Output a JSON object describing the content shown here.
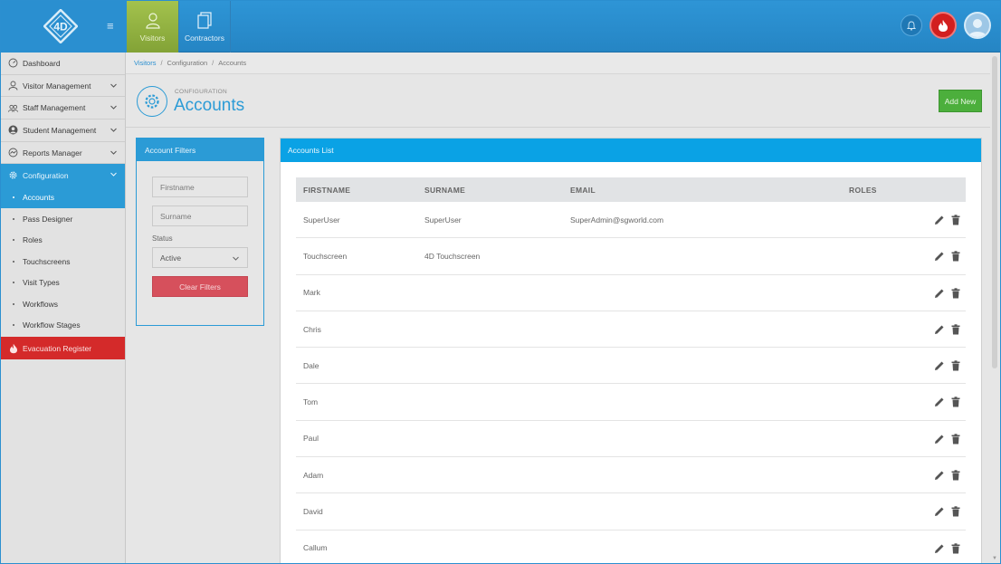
{
  "header": {
    "nav": [
      {
        "label": "Visitors",
        "icon": "person-icon",
        "active": true
      },
      {
        "label": "Contractors",
        "icon": "document-icon",
        "active": false
      }
    ]
  },
  "sidebar": {
    "items": [
      {
        "label": "Dashboard",
        "icon": "dashboard-icon",
        "has_chevron": false
      },
      {
        "label": "Visitor Management",
        "icon": "person-icon",
        "has_chevron": true
      },
      {
        "label": "Staff Management",
        "icon": "group-icon",
        "has_chevron": true
      },
      {
        "label": "Student Management",
        "icon": "student-icon",
        "has_chevron": true
      },
      {
        "label": "Reports Manager",
        "icon": "chart-icon",
        "has_chevron": true
      },
      {
        "label": "Configuration",
        "icon": "gear-icon",
        "has_chevron": true
      }
    ],
    "config_sub": [
      {
        "label": "Accounts",
        "active": true
      },
      {
        "label": "Pass Designer",
        "active": false
      },
      {
        "label": "Roles",
        "active": false
      },
      {
        "label": "Touchscreens",
        "active": false
      },
      {
        "label": "Visit Types",
        "active": false
      },
      {
        "label": "Workflows",
        "active": false
      },
      {
        "label": "Workflow Stages",
        "active": false
      }
    ],
    "evac": {
      "label": "Evacuation Register",
      "icon": "flame-icon"
    }
  },
  "breadcrumb": [
    "Visitors",
    "Configuration",
    "Accounts"
  ],
  "page": {
    "kicker": "CONFIGURATION",
    "title": "Accounts",
    "add_label": "Add New"
  },
  "filters": {
    "title": "Account Filters",
    "firstname_placeholder": "Firstname",
    "surname_placeholder": "Surname",
    "status_label": "Status",
    "status_value": "Active",
    "clear_label": "Clear Filters"
  },
  "list": {
    "title": "Accounts List",
    "columns": [
      "FIRSTNAME",
      "SURNAME",
      "EMAIL",
      "ROLES"
    ],
    "rows": [
      {
        "firstname": "SuperUser",
        "surname": "SuperUser",
        "email": "SuperAdmin@sgworld.com",
        "roles": ""
      },
      {
        "firstname": "Touchscreen",
        "surname": "4D Touchscreen",
        "email": "",
        "roles": ""
      },
      {
        "firstname": "Mark",
        "surname": "",
        "email": "",
        "roles": ""
      },
      {
        "firstname": "Chris",
        "surname": "",
        "email": "",
        "roles": ""
      },
      {
        "firstname": "Dale",
        "surname": "",
        "email": "",
        "roles": ""
      },
      {
        "firstname": "Tom",
        "surname": "",
        "email": "",
        "roles": ""
      },
      {
        "firstname": "Paul",
        "surname": "",
        "email": "",
        "roles": ""
      },
      {
        "firstname": "Adam",
        "surname": "",
        "email": "",
        "roles": ""
      },
      {
        "firstname": "David",
        "surname": "",
        "email": "",
        "roles": ""
      },
      {
        "firstname": "Callum",
        "surname": "",
        "email": "",
        "roles": ""
      }
    ]
  },
  "colors": {
    "primary": "#2b9bd6",
    "header": "#2a8fd0",
    "active_nav": "#a3c24d",
    "add": "#4caf3c",
    "clear": "#d6505c",
    "evac": "#d42a2a"
  }
}
